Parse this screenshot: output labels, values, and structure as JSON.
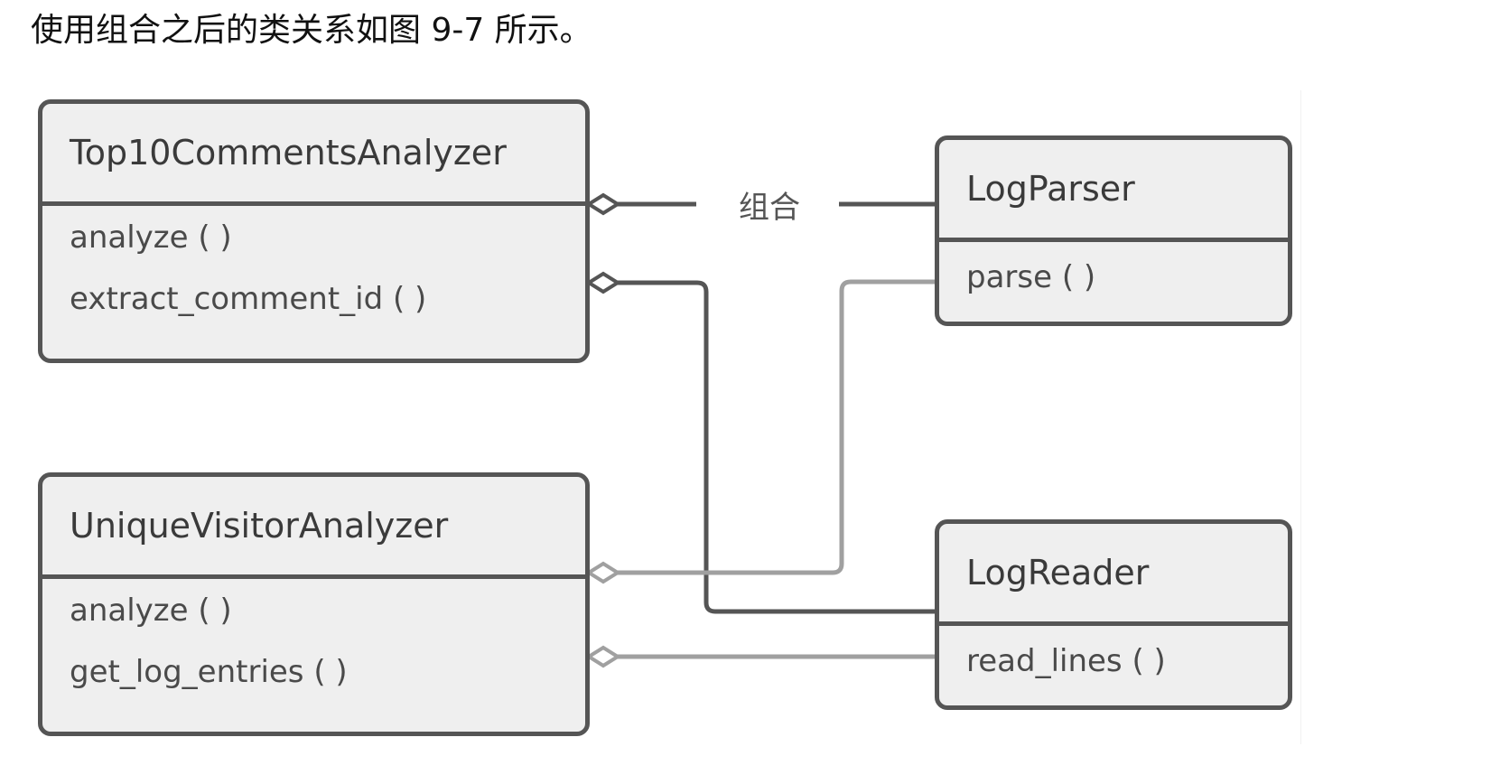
{
  "caption": "使用组合之后的类关系如图 9-7 所示。",
  "diagram": {
    "classes": [
      {
        "id": "top10",
        "name": "Top10CommentsAnalyzer",
        "methods": [
          "analyze ( )",
          "extract_comment_id ( )"
        ]
      },
      {
        "id": "unique",
        "name": "UniqueVisitorAnalyzer",
        "methods": [
          "analyze ( )",
          "get_log_entries ( )"
        ]
      },
      {
        "id": "logparser",
        "name": "LogParser",
        "methods": [
          "parse ( )"
        ]
      },
      {
        "id": "logreader",
        "name": "LogReader",
        "methods": [
          "read_lines ( )"
        ]
      }
    ],
    "relation_label": "组合",
    "relations": [
      {
        "from": "Top10CommentsAnalyzer",
        "to": "LogParser",
        "type": "composition",
        "color": "#555555"
      },
      {
        "from": "Top10CommentsAnalyzer",
        "to": "LogReader",
        "type": "composition",
        "color": "#555555"
      },
      {
        "from": "UniqueVisitorAnalyzer",
        "to": "LogParser",
        "type": "composition",
        "color": "#a0a0a0"
      },
      {
        "from": "UniqueVisitorAnalyzer",
        "to": "LogReader",
        "type": "composition",
        "color": "#a0a0a0"
      }
    ],
    "colors": {
      "dark_line": "#555555",
      "light_line": "#a0a0a0",
      "box_fill": "#efefef",
      "text": "#3a3a3a"
    }
  }
}
